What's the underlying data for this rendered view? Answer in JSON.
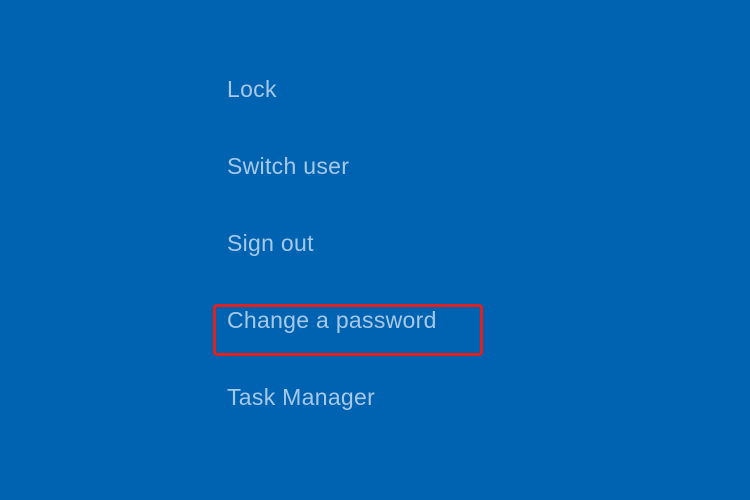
{
  "menu": {
    "items": [
      {
        "label": "Lock"
      },
      {
        "label": "Switch user"
      },
      {
        "label": "Sign out"
      },
      {
        "label": "Change a password"
      },
      {
        "label": "Task Manager"
      }
    ]
  }
}
